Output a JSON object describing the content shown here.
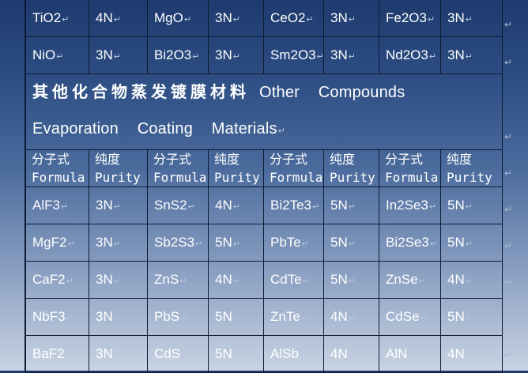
{
  "title": {
    "cn": "其他化合物蒸发镀膜材料",
    "en": "Other Compounds Evaporation Coating Materials"
  },
  "header": {
    "formula_cn": "分子式",
    "formula_en": "Formula",
    "purity_cn": "纯度",
    "purity_en": "Purity"
  },
  "paragraph_mark": "↵",
  "top_rows": [
    [
      [
        "TiO2",
        "4N"
      ],
      [
        "MgO",
        "3N"
      ],
      [
        "CeO2",
        "3N"
      ],
      [
        "Fe2O3",
        "3N"
      ]
    ],
    [
      [
        "NiO",
        "3N"
      ],
      [
        "Bi2O3",
        "3N"
      ],
      [
        "Sm2O3",
        "3N"
      ],
      [
        "Nd2O3",
        "3N"
      ]
    ]
  ],
  "rows": [
    [
      [
        "AlF3",
        "3N"
      ],
      [
        "SnS2",
        "4N"
      ],
      [
        "Bi2Te3",
        "5N"
      ],
      [
        "In2Se3",
        "5N"
      ]
    ],
    [
      [
        "MgF2",
        "3N"
      ],
      [
        "Sb2S3",
        "5N"
      ],
      [
        "PbTe",
        "5N"
      ],
      [
        "Bi2Se3",
        "5N"
      ]
    ],
    [
      [
        "CaF2",
        "3N"
      ],
      [
        "ZnS",
        "4N"
      ],
      [
        "CdTe",
        "5N"
      ],
      [
        "ZnSe",
        "4N"
      ]
    ],
    [
      [
        "NbF3",
        "3N"
      ],
      [
        "PbS",
        "5N"
      ],
      [
        "ZnTe",
        "4N"
      ],
      [
        "CdSe",
        "5N"
      ]
    ],
    [
      [
        "BaF2",
        "3N"
      ],
      [
        "CdS",
        "5N"
      ],
      [
        "AlSb",
        "4N"
      ],
      [
        "AlN",
        "4N"
      ]
    ]
  ],
  "colors": {
    "background_top": "#1e3a6e",
    "background_bottom": "#c9d3e3",
    "text": "#ffffff",
    "grid": "#0c1a33"
  }
}
